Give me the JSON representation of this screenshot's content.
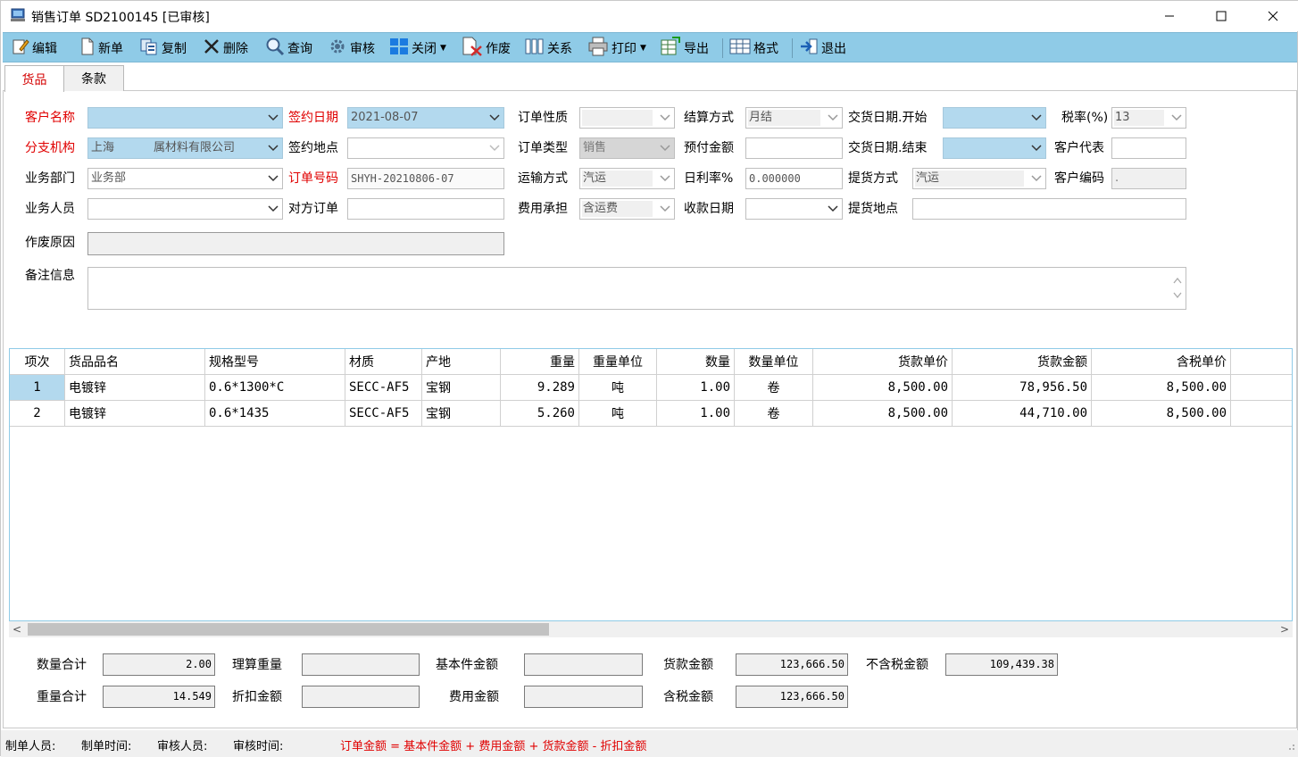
{
  "window": {
    "title": "销售订单 SD2100145  [已审核]",
    "accent": "#8fcbe7"
  },
  "toolbar": {
    "edit": "编辑",
    "new": "新单",
    "copy": "复制",
    "delete": "删除",
    "query": "查询",
    "approve": "审核",
    "close": "关闭",
    "void": "作废",
    "relation": "关系",
    "print": "打印",
    "export": "导出",
    "format": "格式",
    "exit": "退出"
  },
  "tabs": [
    "货品",
    "条款"
  ],
  "form": {
    "customer_name": {
      "label": "客户名称",
      "value": ""
    },
    "sign_date": {
      "label": "签约日期",
      "value": "2021-08-07"
    },
    "order_nature": {
      "label": "订单性质",
      "value": ""
    },
    "settle_method": {
      "label": "结算方式",
      "value": "月结"
    },
    "delivery_start": {
      "label": "交货日期.开始",
      "value": ""
    },
    "tax_rate": {
      "label": "税率(%)",
      "value": "13"
    },
    "branch": {
      "label": "分支机构",
      "value_a": "上海",
      "value_b": "属材料有限公司"
    },
    "sign_place": {
      "label": "签约地点",
      "value": ""
    },
    "order_type": {
      "label": "订单类型",
      "value": "销售"
    },
    "prepay": {
      "label": "预付金额",
      "value": ""
    },
    "delivery_end": {
      "label": "交货日期.结束",
      "value": ""
    },
    "customer_rep": {
      "label": "客户代表",
      "value": ""
    },
    "department": {
      "label": "业务部门",
      "value": "业务部"
    },
    "order_no": {
      "label": "订单号码",
      "value": "SHYH-20210806-07"
    },
    "transport": {
      "label": "运输方式",
      "value": "汽运"
    },
    "daily_rate": {
      "label": "日利率%",
      "value": "0.000000"
    },
    "pickup_method": {
      "label": "提货方式",
      "value": "汽运"
    },
    "customer_code": {
      "label": "客户编码",
      "value": "."
    },
    "salesperson": {
      "label": "业务人员",
      "value": ""
    },
    "counter_order": {
      "label": "对方订单",
      "value": ""
    },
    "fee_bearer": {
      "label": "费用承担",
      "value": "含运费"
    },
    "receive_date": {
      "label": "收款日期",
      "value": ""
    },
    "pickup_place": {
      "label": "提货地点",
      "value": ""
    },
    "void_reason": {
      "label": "作废原因",
      "value": ""
    },
    "remarks": {
      "label": "备注信息",
      "value": ""
    }
  },
  "grid": {
    "columns": [
      "项次",
      "货品品名",
      "规格型号",
      "材质",
      "产地",
      "重量",
      "重量单位",
      "数量",
      "数量单位",
      "货款单价",
      "货款金额",
      "含税单价"
    ],
    "rows": [
      [
        "1",
        "电镀锌",
        "0.6*1300*C",
        "SECC-AF5",
        "宝钢",
        "9.289",
        "吨",
        "1.00",
        "卷",
        "8,500.00",
        "78,956.50",
        "8,500.00"
      ],
      [
        "2",
        "电镀锌",
        "0.6*1435",
        "SECC-AF5",
        "宝钢",
        "5.260",
        "吨",
        "1.00",
        "卷",
        "8,500.00",
        "44,710.00",
        "8,500.00"
      ]
    ]
  },
  "scroll": {
    "left": "<",
    "right": ">"
  },
  "totals": {
    "qty_total": {
      "label": "数量合计",
      "value": "2.00"
    },
    "weight_total": {
      "label": "重量合计",
      "value": "14.549"
    },
    "calc_weight": {
      "label": "理算重量",
      "value": ""
    },
    "discount": {
      "label": "折扣金额",
      "value": ""
    },
    "base_amount": {
      "label": "基本件金额",
      "value": ""
    },
    "fee_amount": {
      "label": "费用金额",
      "value": ""
    },
    "goods_amount": {
      "label": "货款金额",
      "value": "123,666.50"
    },
    "tax_incl_amount": {
      "label": "含税金额",
      "value": "123,666.50"
    },
    "tax_excl_amount": {
      "label": "不含税金额",
      "value": "109,439.38"
    }
  },
  "status": {
    "creator": "制单人员:",
    "create_time": "制单时间:",
    "approver": "审核人员:",
    "approve_time": "审核时间:",
    "formula": "订单金额 = 基本件金额 + 费用金额 + 货款金额 - 折扣金额"
  }
}
